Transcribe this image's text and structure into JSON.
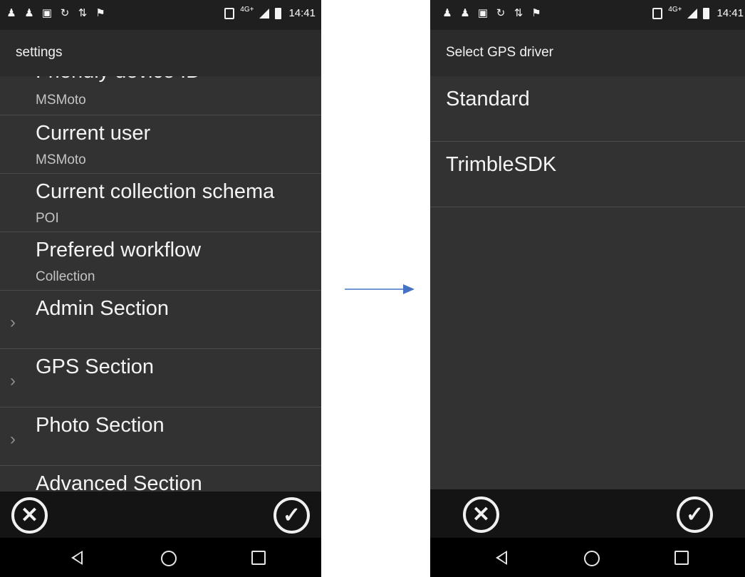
{
  "status_bar": {
    "time": "14:41",
    "network": "4G+",
    "notification_icons": [
      "person-icon",
      "person-icon",
      "image-icon",
      "sync-icon",
      "transfer-icon",
      "flag-icon"
    ]
  },
  "left_screen": {
    "title": "settings",
    "preferences": [
      {
        "title": "Friendly device ID",
        "summary": "MSMoto"
      },
      {
        "title": "Current user",
        "summary": "MSMoto"
      },
      {
        "title": "Current collection schema",
        "summary": "POI"
      },
      {
        "title": "Prefered workflow",
        "summary": "Collection"
      }
    ],
    "sections": [
      {
        "title": "Admin Section"
      },
      {
        "title": "GPS Section"
      },
      {
        "title": "Photo Section"
      },
      {
        "title": "Advanced Section"
      }
    ],
    "actions": {
      "cancel_glyph": "✕",
      "confirm_glyph": "✓"
    }
  },
  "right_screen": {
    "title": "Select GPS driver",
    "options": [
      "Standard",
      "TrimbleSDK"
    ],
    "actions": {
      "cancel_glyph": "✕",
      "confirm_glyph": "✓"
    }
  },
  "nav_icons": [
    "back-icon",
    "home-icon",
    "recents-icon"
  ],
  "colors": {
    "background": "#323232",
    "app_bar": "#2b2b2b",
    "status_bar": "#1f1f1f",
    "action_bar": "#141414",
    "arrow": "#4472c4"
  }
}
